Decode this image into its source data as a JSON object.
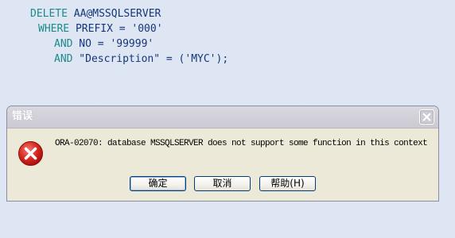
{
  "sql": {
    "line1": {
      "keyword": "DELETE",
      "text": " AA@MSSQLSERVER"
    },
    "line2": {
      "keyword": "WHERE",
      "text": " PREFIX = '000'"
    },
    "line3": {
      "keyword": "AND",
      "text": " NO = '99999'"
    },
    "line4": {
      "keyword": "AND",
      "text": " \"Description\" = ('MYC');"
    }
  },
  "dialog": {
    "title": "错误",
    "message": "ORA-02070: database MSSQLSERVER does not support some function in this context",
    "icon": "error-icon",
    "buttons": {
      "ok": "确定",
      "cancel": "取消",
      "help": "帮助(H)"
    }
  },
  "colors": {
    "background": "#dfe6f3",
    "keyword": "#1d8a8a",
    "code_text": "#14367a",
    "dialog_body": "#ece9d8",
    "error_red": "#c9221f"
  }
}
